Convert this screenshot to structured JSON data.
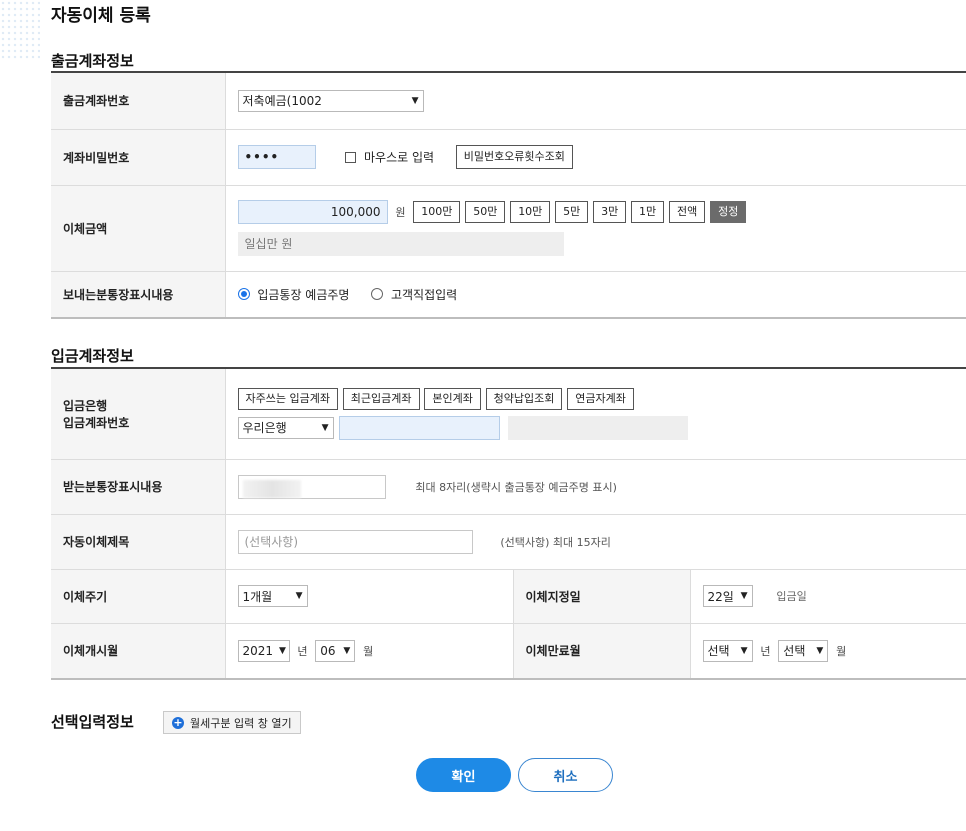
{
  "page": {
    "title": "자동이체 등록"
  },
  "withdraw": {
    "section_title": "출금계좌정보",
    "account_label": "출금계좌번호",
    "account_value": "저축예금(1002",
    "password_label": "계좌비밀번호",
    "password_value": "••••",
    "mouse_input_label": "마우스로 입력",
    "pw_error_btn": "비밀번호오류횟수조회",
    "amount_label": "이체금액",
    "amount_value": "100,000",
    "amount_unit": "원",
    "amount_buttons": [
      "100만",
      "50만",
      "10만",
      "5만",
      "3만",
      "1만",
      "전액"
    ],
    "correct_btn": "정정",
    "amount_korean": "일십만 원",
    "passbook_label": "보내는분통장표시내용",
    "passbook_opt1": "입금통장 예금주명",
    "passbook_opt2": "고객직접입력"
  },
  "deposit": {
    "section_title": "입금계좌정보",
    "bank_label_1": "입금은행",
    "bank_label_2": "입금계좌번호",
    "quick_buttons": [
      "자주쓰는 입금계좌",
      "최근입금계좌",
      "본인계좌",
      "청약납입조회",
      "연금자계좌"
    ],
    "bank_value": "우리은행",
    "recv_label": "받는분통장표시내용",
    "recv_hint": "최대 8자리(생략시 출금통장 예금주명 표시)",
    "title_label": "자동이체제목",
    "title_placeholder": "(선택사항)",
    "title_hint": "(선택사항) 최대 15자리",
    "cycle_label": "이체주기",
    "cycle_value": "1개월",
    "day_label": "이체지정일",
    "day_value": "22일",
    "day_hint": "입금일",
    "start_label": "이체개시월",
    "start_year": "2021",
    "year_unit": "년",
    "start_month": "06",
    "month_unit": "월",
    "end_label": "이체만료월",
    "end_year": "선택",
    "end_month": "선택"
  },
  "optional": {
    "section_title": "선택입력정보",
    "open_btn": "월세구분 입력 창 열기"
  },
  "actions": {
    "ok": "확인",
    "cancel": "취소"
  },
  "colors": {
    "primary": "#1e8ae6",
    "input_bg": "#e8f1fc"
  }
}
